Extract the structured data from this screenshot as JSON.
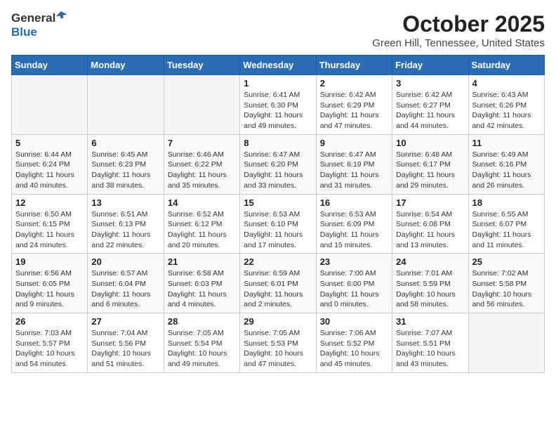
{
  "header": {
    "logo_general": "General",
    "logo_blue": "Blue",
    "title": "October 2025",
    "subtitle": "Green Hill, Tennessee, United States"
  },
  "days_of_week": [
    "Sunday",
    "Monday",
    "Tuesday",
    "Wednesday",
    "Thursday",
    "Friday",
    "Saturday"
  ],
  "weeks": [
    [
      {
        "day": "",
        "info": ""
      },
      {
        "day": "",
        "info": ""
      },
      {
        "day": "",
        "info": ""
      },
      {
        "day": "1",
        "info": "Sunrise: 6:41 AM\nSunset: 6:30 PM\nDaylight: 11 hours and 49 minutes."
      },
      {
        "day": "2",
        "info": "Sunrise: 6:42 AM\nSunset: 6:29 PM\nDaylight: 11 hours and 47 minutes."
      },
      {
        "day": "3",
        "info": "Sunrise: 6:42 AM\nSunset: 6:27 PM\nDaylight: 11 hours and 44 minutes."
      },
      {
        "day": "4",
        "info": "Sunrise: 6:43 AM\nSunset: 6:26 PM\nDaylight: 11 hours and 42 minutes."
      }
    ],
    [
      {
        "day": "5",
        "info": "Sunrise: 6:44 AM\nSunset: 6:24 PM\nDaylight: 11 hours and 40 minutes."
      },
      {
        "day": "6",
        "info": "Sunrise: 6:45 AM\nSunset: 6:23 PM\nDaylight: 11 hours and 38 minutes."
      },
      {
        "day": "7",
        "info": "Sunrise: 6:46 AM\nSunset: 6:22 PM\nDaylight: 11 hours and 35 minutes."
      },
      {
        "day": "8",
        "info": "Sunrise: 6:47 AM\nSunset: 6:20 PM\nDaylight: 11 hours and 33 minutes."
      },
      {
        "day": "9",
        "info": "Sunrise: 6:47 AM\nSunset: 6:19 PM\nDaylight: 11 hours and 31 minutes."
      },
      {
        "day": "10",
        "info": "Sunrise: 6:48 AM\nSunset: 6:17 PM\nDaylight: 11 hours and 29 minutes."
      },
      {
        "day": "11",
        "info": "Sunrise: 6:49 AM\nSunset: 6:16 PM\nDaylight: 11 hours and 26 minutes."
      }
    ],
    [
      {
        "day": "12",
        "info": "Sunrise: 6:50 AM\nSunset: 6:15 PM\nDaylight: 11 hours and 24 minutes."
      },
      {
        "day": "13",
        "info": "Sunrise: 6:51 AM\nSunset: 6:13 PM\nDaylight: 11 hours and 22 minutes."
      },
      {
        "day": "14",
        "info": "Sunrise: 6:52 AM\nSunset: 6:12 PM\nDaylight: 11 hours and 20 minutes."
      },
      {
        "day": "15",
        "info": "Sunrise: 6:53 AM\nSunset: 6:10 PM\nDaylight: 11 hours and 17 minutes."
      },
      {
        "day": "16",
        "info": "Sunrise: 6:53 AM\nSunset: 6:09 PM\nDaylight: 11 hours and 15 minutes."
      },
      {
        "day": "17",
        "info": "Sunrise: 6:54 AM\nSunset: 6:08 PM\nDaylight: 11 hours and 13 minutes."
      },
      {
        "day": "18",
        "info": "Sunrise: 6:55 AM\nSunset: 6:07 PM\nDaylight: 11 hours and 11 minutes."
      }
    ],
    [
      {
        "day": "19",
        "info": "Sunrise: 6:56 AM\nSunset: 6:05 PM\nDaylight: 11 hours and 9 minutes."
      },
      {
        "day": "20",
        "info": "Sunrise: 6:57 AM\nSunset: 6:04 PM\nDaylight: 11 hours and 6 minutes."
      },
      {
        "day": "21",
        "info": "Sunrise: 6:58 AM\nSunset: 6:03 PM\nDaylight: 11 hours and 4 minutes."
      },
      {
        "day": "22",
        "info": "Sunrise: 6:59 AM\nSunset: 6:01 PM\nDaylight: 11 hours and 2 minutes."
      },
      {
        "day": "23",
        "info": "Sunrise: 7:00 AM\nSunset: 6:00 PM\nDaylight: 11 hours and 0 minutes."
      },
      {
        "day": "24",
        "info": "Sunrise: 7:01 AM\nSunset: 5:59 PM\nDaylight: 10 hours and 58 minutes."
      },
      {
        "day": "25",
        "info": "Sunrise: 7:02 AM\nSunset: 5:58 PM\nDaylight: 10 hours and 56 minutes."
      }
    ],
    [
      {
        "day": "26",
        "info": "Sunrise: 7:03 AM\nSunset: 5:57 PM\nDaylight: 10 hours and 54 minutes."
      },
      {
        "day": "27",
        "info": "Sunrise: 7:04 AM\nSunset: 5:56 PM\nDaylight: 10 hours and 51 minutes."
      },
      {
        "day": "28",
        "info": "Sunrise: 7:05 AM\nSunset: 5:54 PM\nDaylight: 10 hours and 49 minutes."
      },
      {
        "day": "29",
        "info": "Sunrise: 7:05 AM\nSunset: 5:53 PM\nDaylight: 10 hours and 47 minutes."
      },
      {
        "day": "30",
        "info": "Sunrise: 7:06 AM\nSunset: 5:52 PM\nDaylight: 10 hours and 45 minutes."
      },
      {
        "day": "31",
        "info": "Sunrise: 7:07 AM\nSunset: 5:51 PM\nDaylight: 10 hours and 43 minutes."
      },
      {
        "day": "",
        "info": ""
      }
    ]
  ]
}
